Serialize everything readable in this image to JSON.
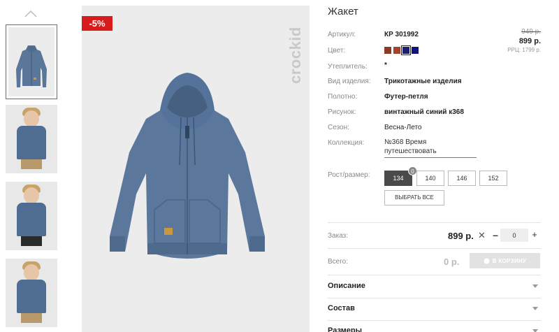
{
  "product": {
    "title": "Жакет",
    "sale_badge": "-5%",
    "brand": "crockid"
  },
  "pricing": {
    "old_price": "949 р.",
    "new_price": "899 р.",
    "rrp": "РРЦ: 1799 р."
  },
  "specs": {
    "article_label": "Артикул:",
    "article_value": "КР 301992",
    "color_label": "Цвет:",
    "insulation_label": "Утеплитель:",
    "insulation_value": "*",
    "type_label": "Вид изделия:",
    "type_value": "Трикотажные изделия",
    "fabric_label": "Полотно:",
    "fabric_value": "Футер-петля",
    "pattern_label": "Рисунок:",
    "pattern_value": "винтажный синий к368",
    "season_label": "Сезон:",
    "season_value": "Весна-Лето",
    "collection_label": "Коллекция:",
    "collection_value": "№368 Время путешествовать"
  },
  "colors": [
    {
      "name": "brown",
      "hex": "#8b3a24"
    },
    {
      "name": "rust",
      "hex": "#a0452b"
    },
    {
      "name": "navy-selected",
      "hex": "#1c1e6f"
    },
    {
      "name": "navy",
      "hex": "#12137a"
    }
  ],
  "sizes": {
    "label": "Рост/размер:",
    "options": [
      "134",
      "140",
      "146",
      "152"
    ],
    "selected": "134",
    "badge": "0",
    "select_all": "ВЫБРАТЬ ВСЕ"
  },
  "order": {
    "label": "Заказ:",
    "price": "899 р.",
    "remove_symbol": "✕",
    "minus": "–",
    "quantity": "0",
    "plus": "+"
  },
  "total": {
    "label": "Всего:",
    "value": "0 р.",
    "cart_button": "В КОРЗИНУ"
  },
  "accordion": [
    {
      "label": "Описание"
    },
    {
      "label": "Состав"
    },
    {
      "label": "Размеры"
    }
  ]
}
